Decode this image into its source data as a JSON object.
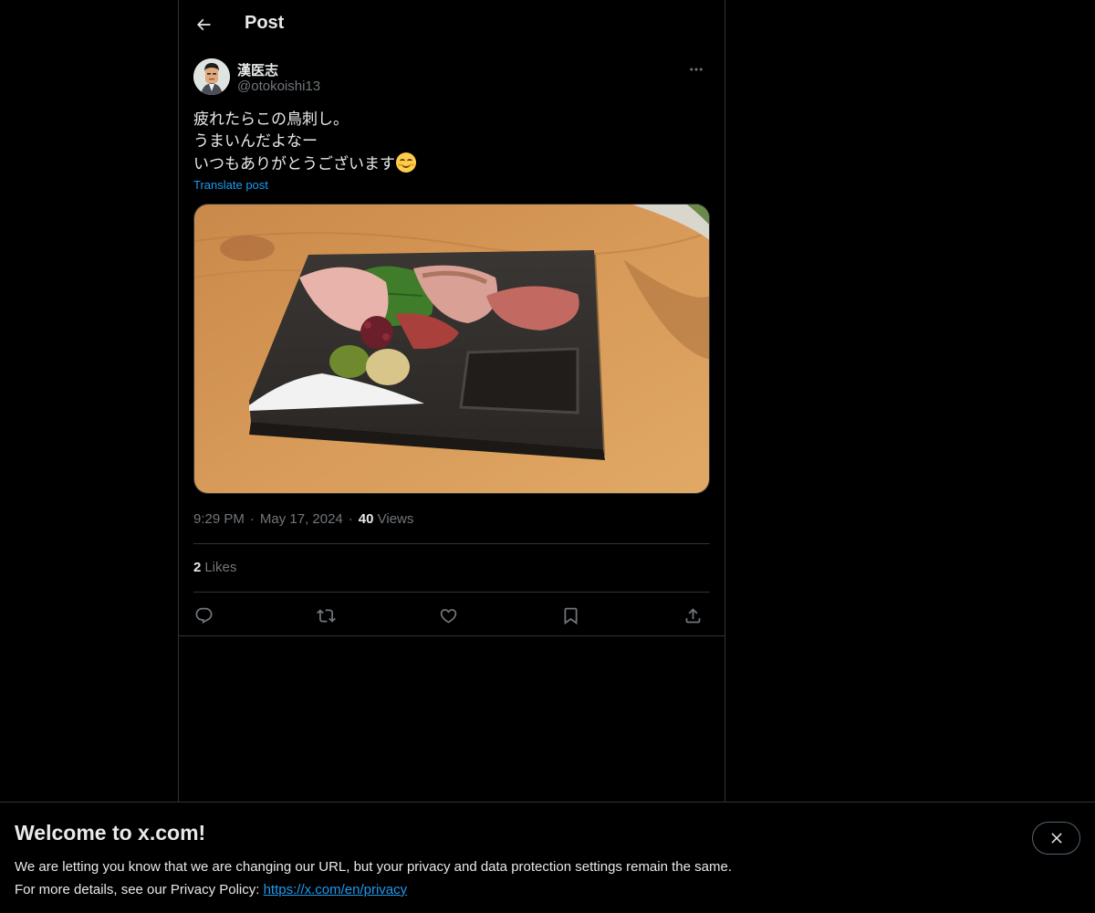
{
  "header": {
    "title": "Post",
    "back_icon": "arrow-left-icon"
  },
  "post": {
    "author": {
      "display_name": "漢医志",
      "handle": "@otokoishi13",
      "avatar_icon": "illustrated-man-avatar"
    },
    "more_icon": "ellipsis-icon",
    "text_lines": [
      "疲れたらこの鳥刺し。",
      "うまいんだよなー",
      "いつもありがとうございます"
    ],
    "emoji": "smiling-face-emoji",
    "translate_label": "Translate post",
    "media_icon": "photo-chicken-sashimi-plate",
    "time": "9:29 PM",
    "date": "May 17, 2024",
    "separator": "·",
    "views_count": "40",
    "views_label": "Views",
    "likes_count": "2",
    "likes_label": "Likes"
  },
  "actions": [
    "reply-icon",
    "repost-icon",
    "like-icon",
    "bookmark-icon",
    "share-icon"
  ],
  "banner": {
    "title": "Welcome to x.com!",
    "line1": "We are letting you know that we are changing our URL, but your privacy and data protection settings remain the same.",
    "line2_prefix": "For more details, see our Privacy Policy: ",
    "link": "https://x.com/en/privacy",
    "close_icon": "close-icon"
  },
  "colors": {
    "background": "#000000",
    "text": "#e7e9ea",
    "secondary": "#71767b",
    "accent": "#1d9bf0",
    "border": "#2f3336"
  }
}
